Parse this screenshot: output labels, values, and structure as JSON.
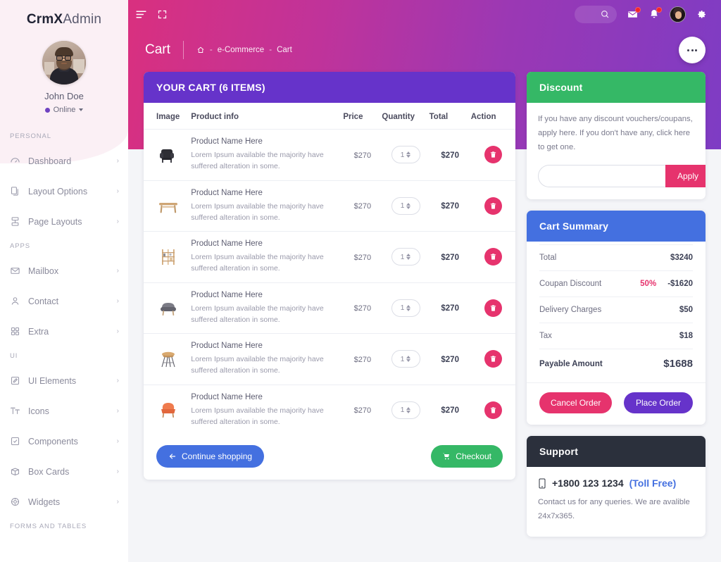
{
  "brand": {
    "bold": "CrmX",
    "light": "Admin"
  },
  "profile": {
    "name": "John Doe",
    "status": "Online"
  },
  "sidebar": {
    "sections": [
      {
        "title": "PERSONAL",
        "items": [
          {
            "label": "Dashboard",
            "icon": "dashboard-icon",
            "arrow": "›"
          },
          {
            "label": "Layout Options",
            "icon": "layers-icon",
            "arrow": "›"
          },
          {
            "label": "Page Layouts",
            "icon": "page-layout-icon",
            "arrow": "›"
          }
        ]
      },
      {
        "title": "APPS",
        "items": [
          {
            "label": "Mailbox",
            "icon": "mail-icon",
            "arrow": "›"
          },
          {
            "label": "Contact",
            "icon": "user-icon",
            "arrow": "›"
          },
          {
            "label": "Extra",
            "icon": "grid-icon",
            "arrow": "›"
          }
        ]
      },
      {
        "title": "UI",
        "items": [
          {
            "label": "UI Elements",
            "icon": "pen-square-icon",
            "arrow": "›"
          },
          {
            "label": "Icons",
            "icon": "typography-icon",
            "arrow": "›"
          },
          {
            "label": "Components",
            "icon": "check-square-icon",
            "arrow": "›"
          },
          {
            "label": "Box Cards",
            "icon": "box-icon",
            "arrow": "›"
          },
          {
            "label": "Widgets",
            "icon": "widget-icon",
            "arrow": "›"
          }
        ]
      },
      {
        "title": "FORMS And TABLES",
        "items": []
      }
    ]
  },
  "topbar": {
    "menu_icon": "hamburger-icon",
    "fullscreen_icon": "expand-icon",
    "search_icon": "search-icon",
    "mail_icon": "envelope-icon",
    "bell_icon": "bell-icon",
    "avatar": "user-avatar",
    "gear_icon": "gear-icon"
  },
  "page": {
    "title": "Cart",
    "breadcrumb": {
      "home_icon": "home-icon",
      "sep": "-",
      "items": [
        "e-Commerce",
        "Cart"
      ]
    },
    "fab": "more-options-button"
  },
  "cart": {
    "header": "YOUR CART (6 ITEMS)",
    "columns": [
      "Image",
      "Product info",
      "Price",
      "Quantity",
      "Total",
      "Action"
    ],
    "rows": [
      {
        "thumb": "black-armchair",
        "name": "Product Name Here",
        "desc": "Lorem Ipsum available the majority have suffered alteration in some.",
        "price": "$270",
        "qty": "1",
        "total": "$270",
        "action": "trash-icon"
      },
      {
        "thumb": "wood-table",
        "name": "Product Name Here",
        "desc": "Lorem Ipsum available the majority have suffered alteration in some.",
        "price": "$270",
        "qty": "1",
        "total": "$270",
        "action": "trash-icon"
      },
      {
        "thumb": "shelf-unit",
        "name": "Product Name Here",
        "desc": "Lorem Ipsum available the majority have suffered alteration in some.",
        "price": "$270",
        "qty": "1",
        "total": "$270",
        "action": "trash-icon"
      },
      {
        "thumb": "gray-chair",
        "name": "Product Name Here",
        "desc": "Lorem Ipsum available the majority have suffered alteration in some.",
        "price": "$270",
        "qty": "1",
        "total": "$270",
        "action": "trash-icon"
      },
      {
        "thumb": "wood-stool",
        "name": "Product Name Here",
        "desc": "Lorem Ipsum available the majority have suffered alteration in some.",
        "price": "$270",
        "qty": "1",
        "total": "$270",
        "action": "trash-icon"
      },
      {
        "thumb": "orange-chair",
        "name": "Product Name Here",
        "desc": "Lorem Ipsum available the majority have suffered alteration in some.",
        "price": "$270",
        "qty": "1",
        "total": "$270",
        "action": "trash-icon"
      }
    ],
    "continue_label": "Continue shopping",
    "checkout_label": "Checkout"
  },
  "discount": {
    "header": "Discount",
    "text": "If you have any discount vouchers/coupans, apply here. If you don't have any, click here to get one.",
    "input_value": "",
    "input_placeholder": "",
    "apply_label": "Apply"
  },
  "summary": {
    "header": "Cart Summary",
    "rows": [
      {
        "label": "Total",
        "pct": "",
        "value": "$3240"
      },
      {
        "label": "Coupan Discount",
        "pct": "50%",
        "value": "-$1620"
      },
      {
        "label": "Delivery Charges",
        "pct": "",
        "value": "$50"
      },
      {
        "label": "Tax",
        "pct": "",
        "value": "$18"
      }
    ],
    "payable": {
      "label": "Payable Amount",
      "value": "$1688"
    },
    "cancel_label": "Cancel Order",
    "place_label": "Place Order"
  },
  "support": {
    "header": "Support",
    "phone": "+1800 123 1234",
    "toll": "(Toll Free)",
    "text": "Contact us for any queries. We are avalible 24x7x365.",
    "phone_icon": "mobile-icon"
  },
  "colors": {
    "accent_pink": "#e6336d",
    "accent_purple": "#6633ca",
    "accent_blue": "#4470e0",
    "accent_green": "#35b866",
    "header_dark": "#2b303c"
  }
}
